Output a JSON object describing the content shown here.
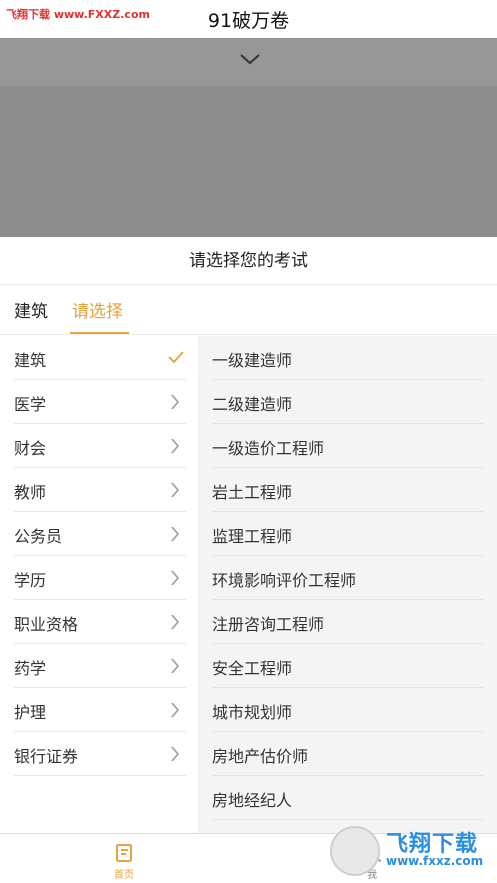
{
  "watermark": {
    "top_text": "飞翔下载 www.FXXZ.com",
    "logo_title": "飞翔下载",
    "logo_url": "www.fxxz.com"
  },
  "app": {
    "title": "91破万卷"
  },
  "sheet": {
    "title": "请选择您的考试",
    "breadcrumb": [
      "建筑",
      "请选择"
    ]
  },
  "categories": [
    {
      "label": "建筑",
      "selected": true
    },
    {
      "label": "医学",
      "selected": false
    },
    {
      "label": "财会",
      "selected": false
    },
    {
      "label": "教师",
      "selected": false
    },
    {
      "label": "公务员",
      "selected": false
    },
    {
      "label": "学历",
      "selected": false
    },
    {
      "label": "职业资格",
      "selected": false
    },
    {
      "label": "药学",
      "selected": false
    },
    {
      "label": "护理",
      "selected": false
    },
    {
      "label": "银行证券",
      "selected": false
    }
  ],
  "exams": [
    "一级建造师",
    "二级建造师",
    "一级造价工程师",
    "岩土工程师",
    "监理工程师",
    "环境影响评价工程师",
    "注册咨询工程师",
    "安全工程师",
    "城市规划师",
    "房地产估价师",
    "房地经纪人"
  ],
  "tabs": {
    "home": "首页",
    "me": "我"
  },
  "colors": {
    "accent": "#e6a23c",
    "overlay": "#8c8c8c",
    "sublist_bg": "#f4f4f4"
  }
}
